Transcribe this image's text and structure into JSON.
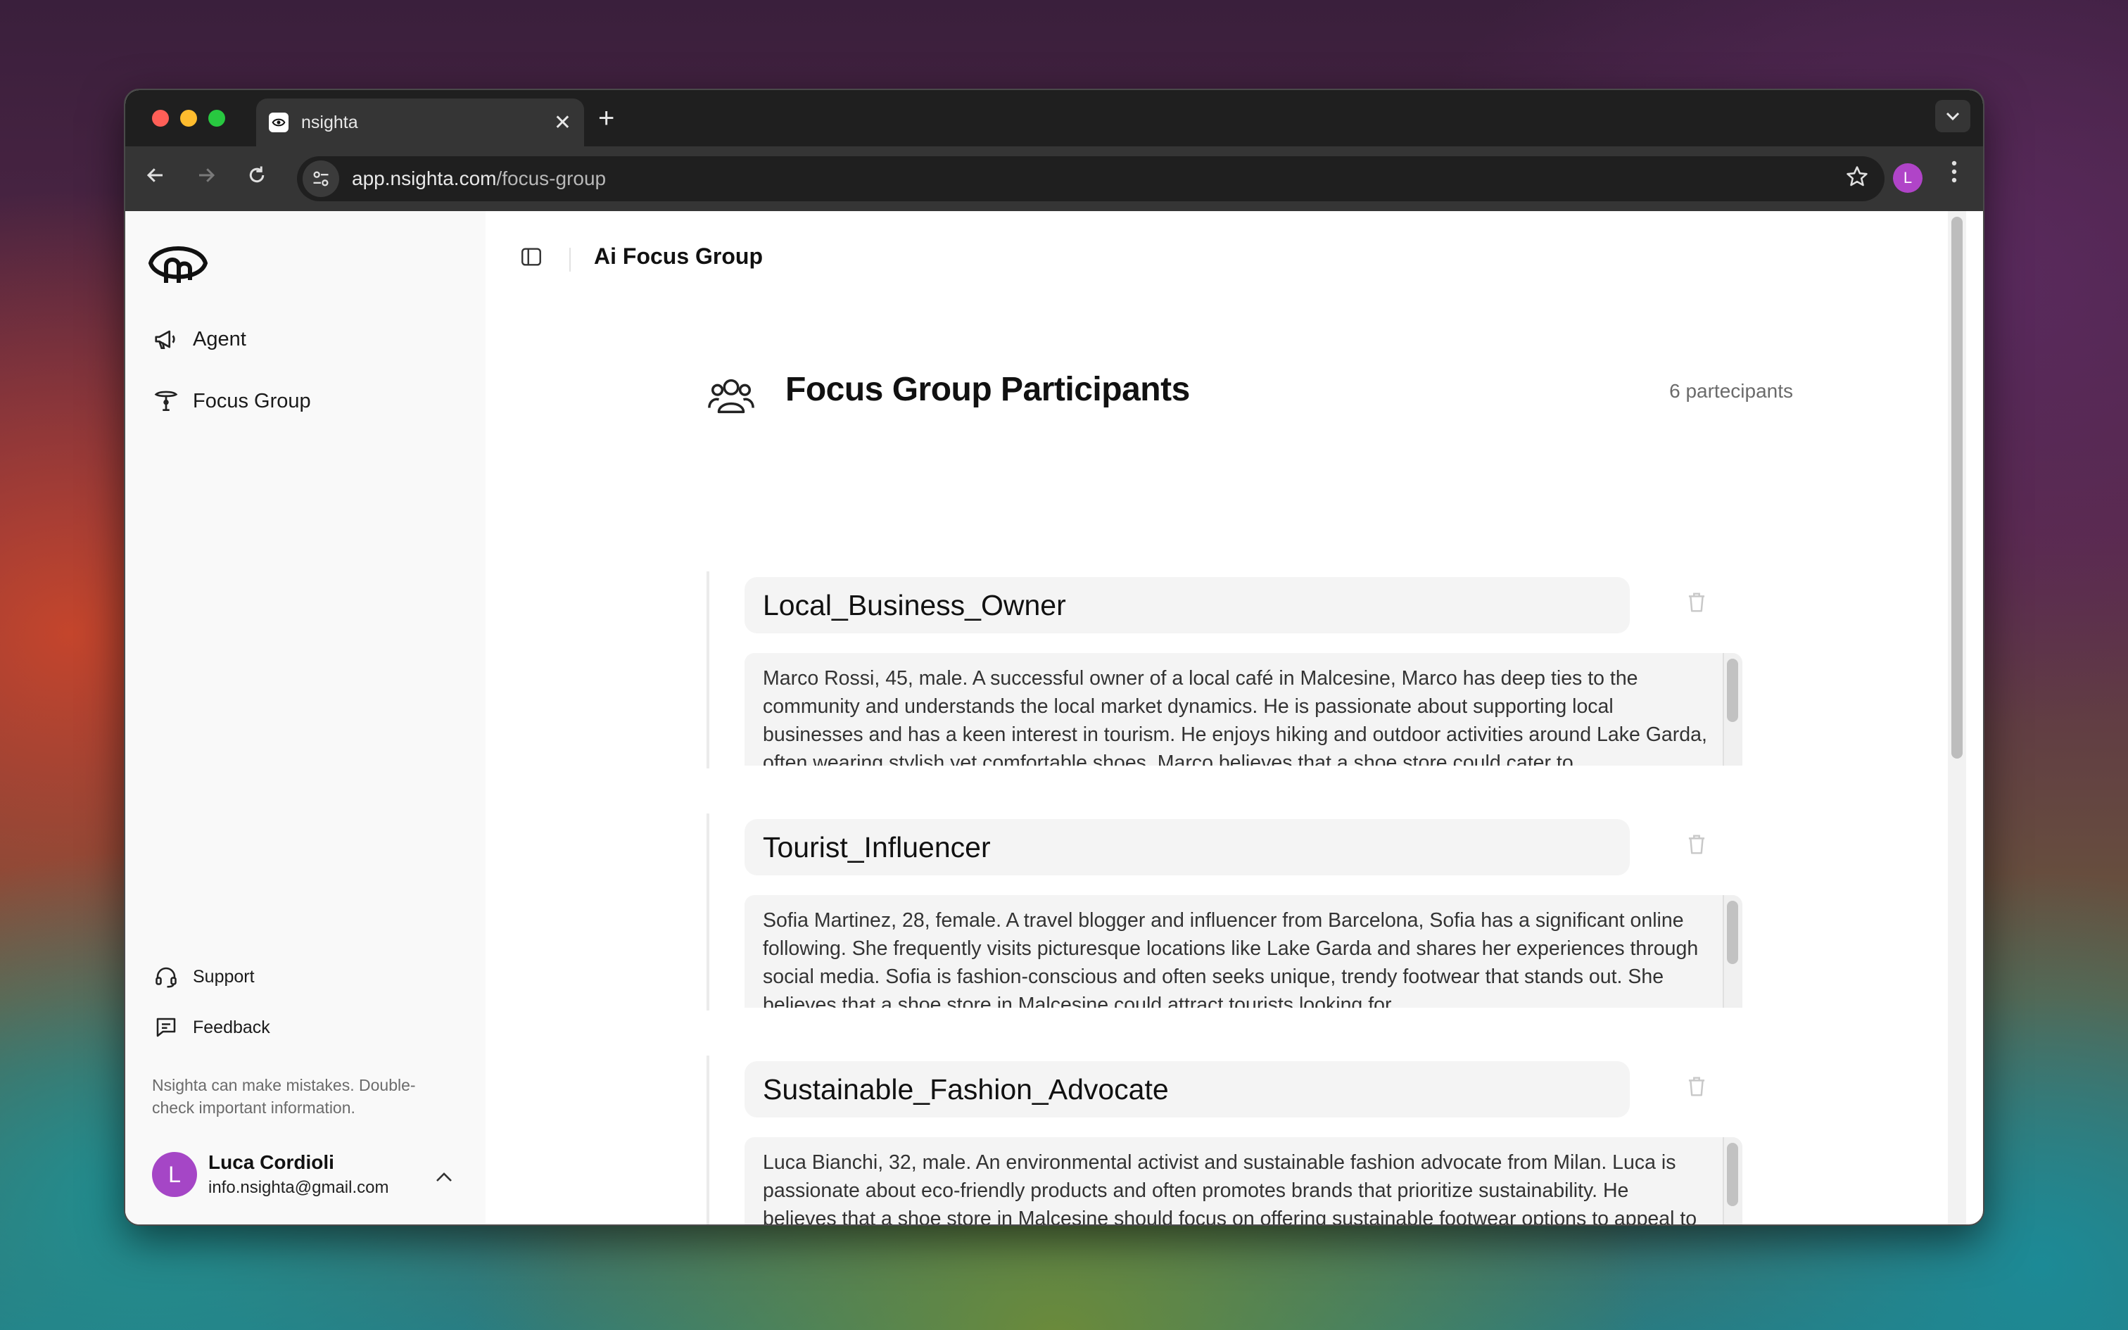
{
  "browser": {
    "tab_title": "nsighta",
    "url_host": "app.nsighta.com",
    "url_path": "/focus-group",
    "profile_initial": "L"
  },
  "sidebar": {
    "nav": [
      {
        "label": "Agent",
        "icon": "megaphone-icon"
      },
      {
        "label": "Focus Group",
        "icon": "lamp-icon"
      }
    ],
    "footer": [
      {
        "label": "Support",
        "icon": "headset-icon"
      },
      {
        "label": "Feedback",
        "icon": "message-square-icon"
      }
    ],
    "disclaimer": "Nsighta can make mistakes. Double-check important information.",
    "user": {
      "initial": "L",
      "name": "Luca Cordioli",
      "email": "info.nsighta@gmail.com"
    }
  },
  "header": {
    "title": "Ai Focus Group"
  },
  "participants": {
    "title": "Focus Group Participants",
    "count": "6 partecipants",
    "items": [
      {
        "name": "Local_Business_Owner",
        "description": "Marco Rossi, 45, male. A successful owner of a local café in Malcesine, Marco has deep ties to the community and understands the local market dynamics. He is passionate about supporting local businesses and has a keen interest in tourism. He enjoys hiking and outdoor activities around Lake Garda, often wearing stylish yet comfortable shoes. Marco believes that a shoe store could cater to"
      },
      {
        "name": "Tourist_Influencer",
        "description": "Sofia Martinez, 28, female. A travel blogger and influencer from Barcelona, Sofia has a significant online following. She frequently visits picturesque locations like Lake Garda and shares her experiences through social media. Sofia is fashion-conscious and often seeks unique, trendy footwear that stands out. She believes that a shoe store in Malcesine could attract tourists looking for"
      },
      {
        "name": "Sustainable_Fashion_Advocate",
        "description": "Luca Bianchi, 32, male. An environmental activist and sustainable fashion advocate from Milan. Luca is passionate about eco-friendly products and often promotes brands that prioritize sustainability. He believes that a shoe store in Malcesine should focus on offering sustainable footwear options to appeal to environmentally conscious consumers. Luca enjoys outdoor activities and often"
      }
    ]
  },
  "colors": {
    "accent": "#a546c6",
    "card_bg": "#f4f4f4",
    "sidebar_bg": "#f9f9f9"
  }
}
